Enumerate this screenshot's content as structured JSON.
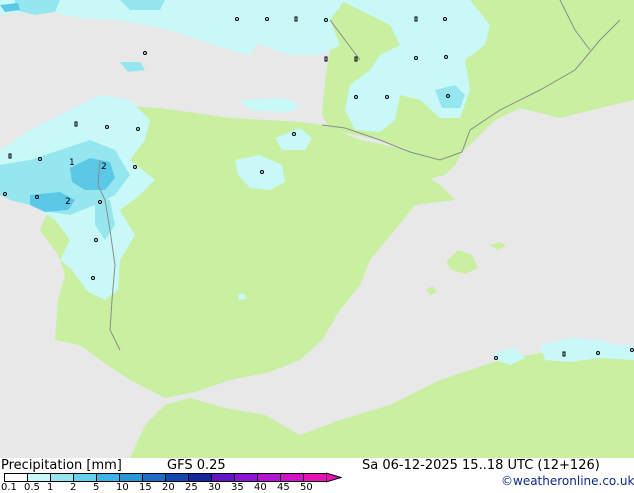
{
  "map": {
    "contour_labels": [
      "1",
      "2",
      "2"
    ],
    "colors": {
      "sea": "#e8e8e8",
      "land": "#c8f0a0",
      "precip_light": "#c8f8f8",
      "precip_mid": "#96e6f0",
      "precip_heavy": "#5ac8e6",
      "border": "#8c8c8c",
      "station": "#000000"
    }
  },
  "footer": {
    "title": "Precipitation [mm]",
    "model": "GFS 0.25",
    "datetime": "Sa 06-12-2025 15..18 UTC (12+126)",
    "credit": "©weatheronline.co.uk"
  },
  "legend": {
    "levels": [
      {
        "label": "0.1",
        "color": "#ffffff"
      },
      {
        "label": "0.5",
        "color": "#c8f8f8"
      },
      {
        "label": "1",
        "color": "#96e6f0"
      },
      {
        "label": "2",
        "color": "#64d2ee"
      },
      {
        "label": "5",
        "color": "#3cb4e6"
      },
      {
        "label": "10",
        "color": "#2896d8"
      },
      {
        "label": "15",
        "color": "#1e6ec8"
      },
      {
        "label": "20",
        "color": "#1446b4"
      },
      {
        "label": "25",
        "color": "#1428a0"
      },
      {
        "label": "30",
        "color": "#6414c8"
      },
      {
        "label": "35",
        "color": "#8c14d2"
      },
      {
        "label": "40",
        "color": "#b414d2"
      },
      {
        "label": "45",
        "color": "#d214c8"
      },
      {
        "label": "50",
        "color": "#e614b4"
      }
    ]
  }
}
